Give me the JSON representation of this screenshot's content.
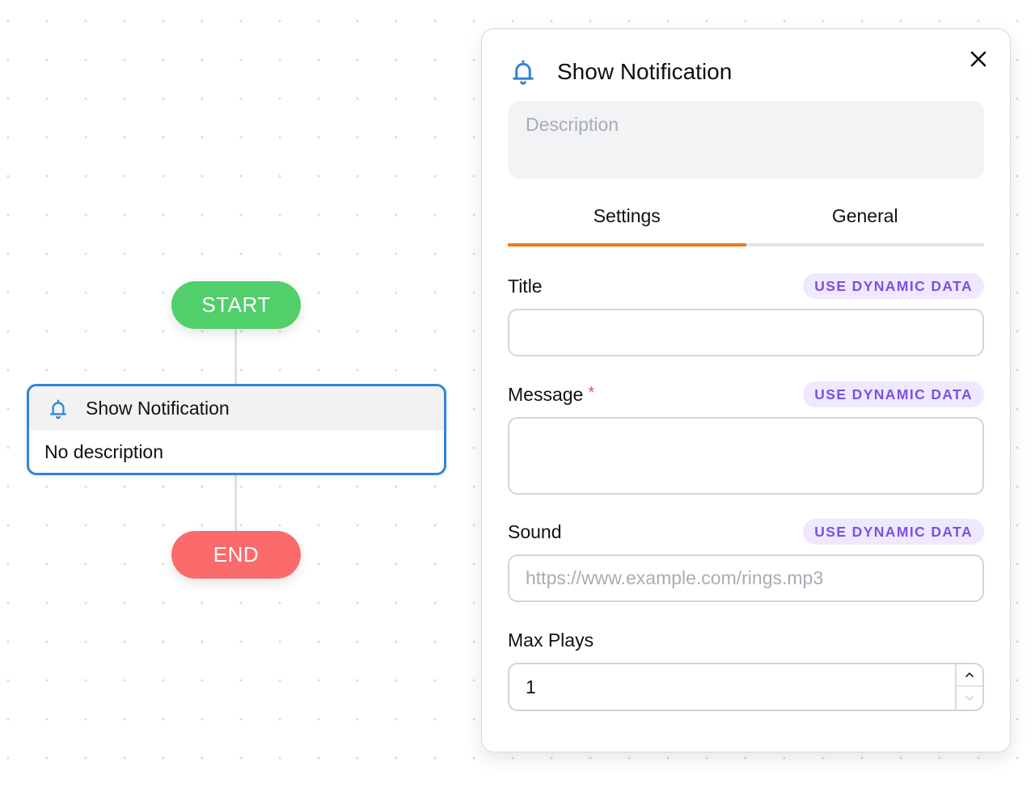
{
  "canvas": {
    "start_label": "START",
    "end_label": "END",
    "node": {
      "icon": "bell-icon",
      "title": "Show Notification",
      "description": "No description"
    }
  },
  "panel": {
    "icon": "bell-icon",
    "title": "Show Notification",
    "close_icon": "close-icon",
    "description_placeholder": "Description",
    "description_value": "",
    "tabs": [
      {
        "label": "Settings",
        "active": true
      },
      {
        "label": "General",
        "active": false
      }
    ],
    "dynamic_data_label": "USE DYNAMIC DATA",
    "fields": {
      "title": {
        "label": "Title",
        "value": "",
        "placeholder": ""
      },
      "message": {
        "label": "Message",
        "required_mark": "*",
        "value": "",
        "placeholder": ""
      },
      "sound": {
        "label": "Sound",
        "value": "",
        "placeholder": "https://www.example.com/rings.mp3"
      },
      "max_plays": {
        "label": "Max Plays",
        "value": "1"
      }
    }
  },
  "colors": {
    "start": "#51cf6a",
    "end": "#fb6b6b",
    "node_border": "#2f86d6",
    "icon_blue": "#2f86d6",
    "tab_active": "#ef7a1e",
    "dynamic_text": "#7a52e0",
    "dynamic_bg": "#efe8fe",
    "required": "#ef4b4b"
  }
}
